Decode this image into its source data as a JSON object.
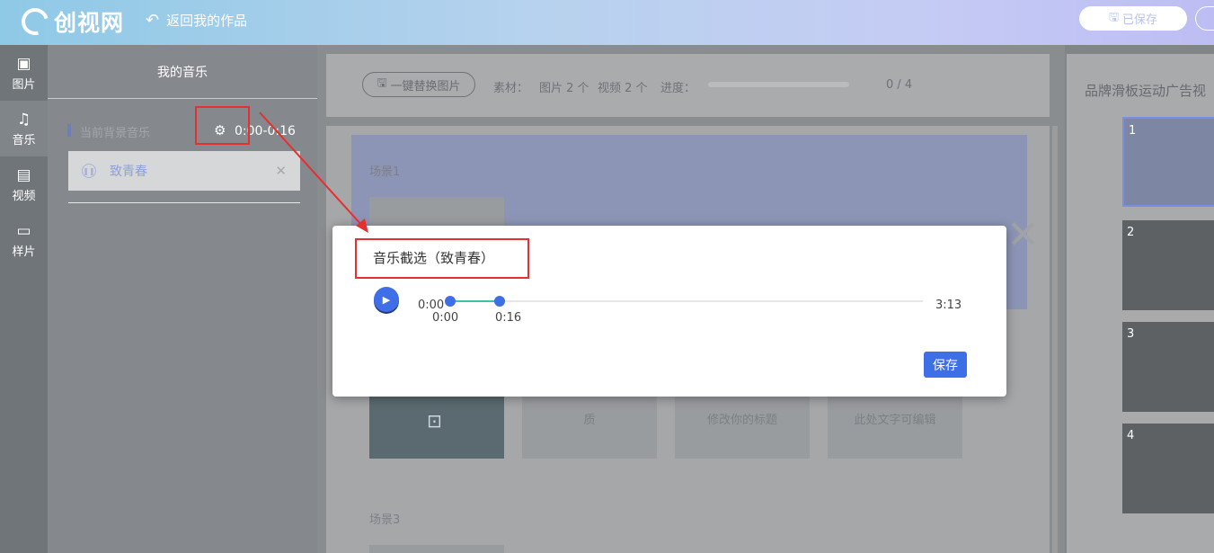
{
  "header": {
    "logo_text": "创视网",
    "back_label": "返回我的作品",
    "saved_label": "已保存"
  },
  "rail": {
    "items": [
      {
        "label": "图片",
        "icon": "image-icon"
      },
      {
        "label": "音乐",
        "icon": "music-icon"
      },
      {
        "label": "视频",
        "icon": "film-icon"
      },
      {
        "label": "样片",
        "icon": "laptop-icon"
      }
    ]
  },
  "music_panel": {
    "title": "我的音乐",
    "current_label": "当前背景音乐",
    "range": "0:00-0:16",
    "track_name": "致青春"
  },
  "toolbar": {
    "replace_label": "一键替换图片",
    "material_label": "素材：",
    "image_count": "图片 2 个",
    "video_count": "视频 2 个",
    "progress_label": "进度：",
    "progress_text": "0 / 4",
    "progress_fraction": 0
  },
  "scenes": {
    "scene1": "场景1",
    "scene3": "场景3",
    "cell_texts": [
      "质",
      "修改你的标题",
      "此处文字可编辑"
    ]
  },
  "right_panel": {
    "title": "品牌滑板运动广告视",
    "slides": [
      "1",
      "2",
      "3",
      "4"
    ]
  },
  "modal": {
    "title": "音乐截选（致青春）",
    "time_start": "0:00",
    "time_end": "3:13",
    "handle_start": "0:00",
    "handle_end": "0:16",
    "save_label": "保存"
  },
  "colors": {
    "accent": "#3f6fe6",
    "slider_fill": "#3cc3a6",
    "annotation_red": "#e53030"
  }
}
